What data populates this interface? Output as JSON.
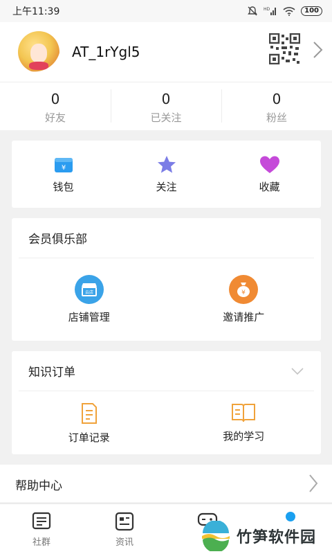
{
  "status_bar": {
    "time": "上午11:39",
    "battery": "100"
  },
  "profile": {
    "username": "AT_1rYgl5"
  },
  "stats": [
    {
      "value": "0",
      "label": "好友"
    },
    {
      "value": "0",
      "label": "已关注"
    },
    {
      "value": "0",
      "label": "粉丝"
    }
  ],
  "quick_actions": [
    {
      "label": "钱包",
      "icon": "wallet-icon",
      "color": "#2b9cf0"
    },
    {
      "label": "关注",
      "icon": "star-icon",
      "color": "#7b7de6"
    },
    {
      "label": "收藏",
      "icon": "heart-icon",
      "color": "#c54ad9"
    }
  ],
  "club": {
    "title": "会员俱乐部",
    "items": [
      {
        "label": "店铺管理",
        "icon": "store-icon",
        "color": "#3aa3e8"
      },
      {
        "label": "邀请推广",
        "icon": "money-bag-icon",
        "color": "#f08a33"
      }
    ]
  },
  "orders": {
    "title": "知识订单",
    "items": [
      {
        "label": "订单记录",
        "icon": "document-icon",
        "color": "#f0a23a"
      },
      {
        "label": "我的学习",
        "icon": "book-icon",
        "color": "#f0a23a"
      }
    ]
  },
  "settings_row": {
    "label": "帮助中心"
  },
  "tabbar": [
    {
      "label": "社群",
      "icon": "community-icon"
    },
    {
      "label": "资讯",
      "icon": "news-icon"
    },
    {
      "label": "",
      "icon": "game-icon"
    },
    {
      "label": "",
      "icon": "profile-icon"
    }
  ],
  "watermark": {
    "text": "竹笋软件园"
  }
}
